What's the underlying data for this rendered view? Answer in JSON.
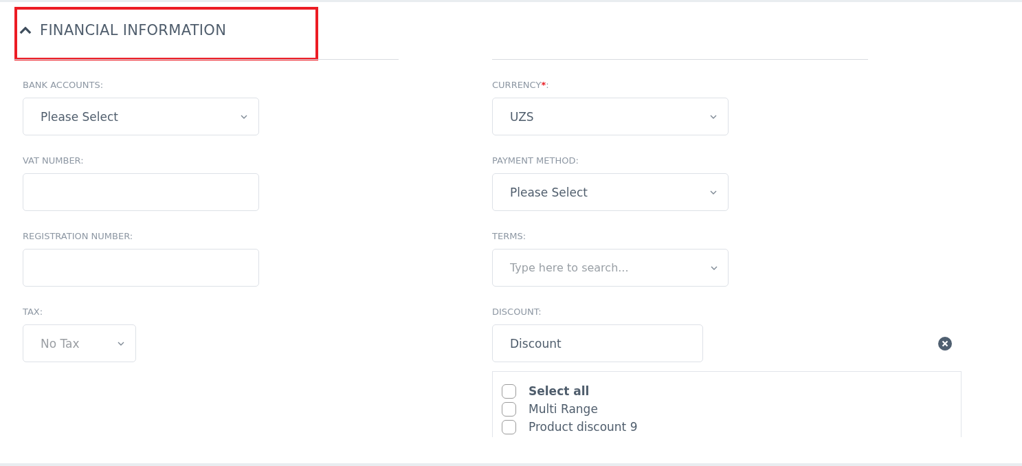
{
  "section": {
    "title": "FINANCIAL INFORMATION",
    "expanded": true
  },
  "left_fields": [
    {
      "kind": "select",
      "label": "BANK ACCOUNTS:",
      "value": "Please Select",
      "muted": false
    },
    {
      "kind": "input",
      "label": "VAT NUMBER:"
    },
    {
      "kind": "input",
      "label": "REGISTRATION NUMBER:"
    },
    {
      "kind": "compact_select",
      "label": "TAX:",
      "value": "No Tax",
      "muted": true
    }
  ],
  "right_fields": [
    {
      "kind": "select",
      "label": "CURRENCY",
      "required_mark": "*",
      "label_end": ":",
      "value": "UZS",
      "muted": false
    },
    {
      "kind": "select",
      "label": "PAYMENT METHOD:",
      "value": "Please Select",
      "muted": false
    },
    {
      "kind": "search",
      "label": "TERMS:",
      "placeholder": "Type here to search..."
    },
    {
      "kind": "multiselect",
      "label": "DISCOUNT:",
      "value": "Discount",
      "options": [
        {
          "label": "Select all",
          "bold": true,
          "checked": false
        },
        {
          "label": "Multi Range",
          "bold": false,
          "checked": false
        },
        {
          "label": "Product discount 9",
          "bold": false,
          "checked": false
        }
      ]
    }
  ]
}
